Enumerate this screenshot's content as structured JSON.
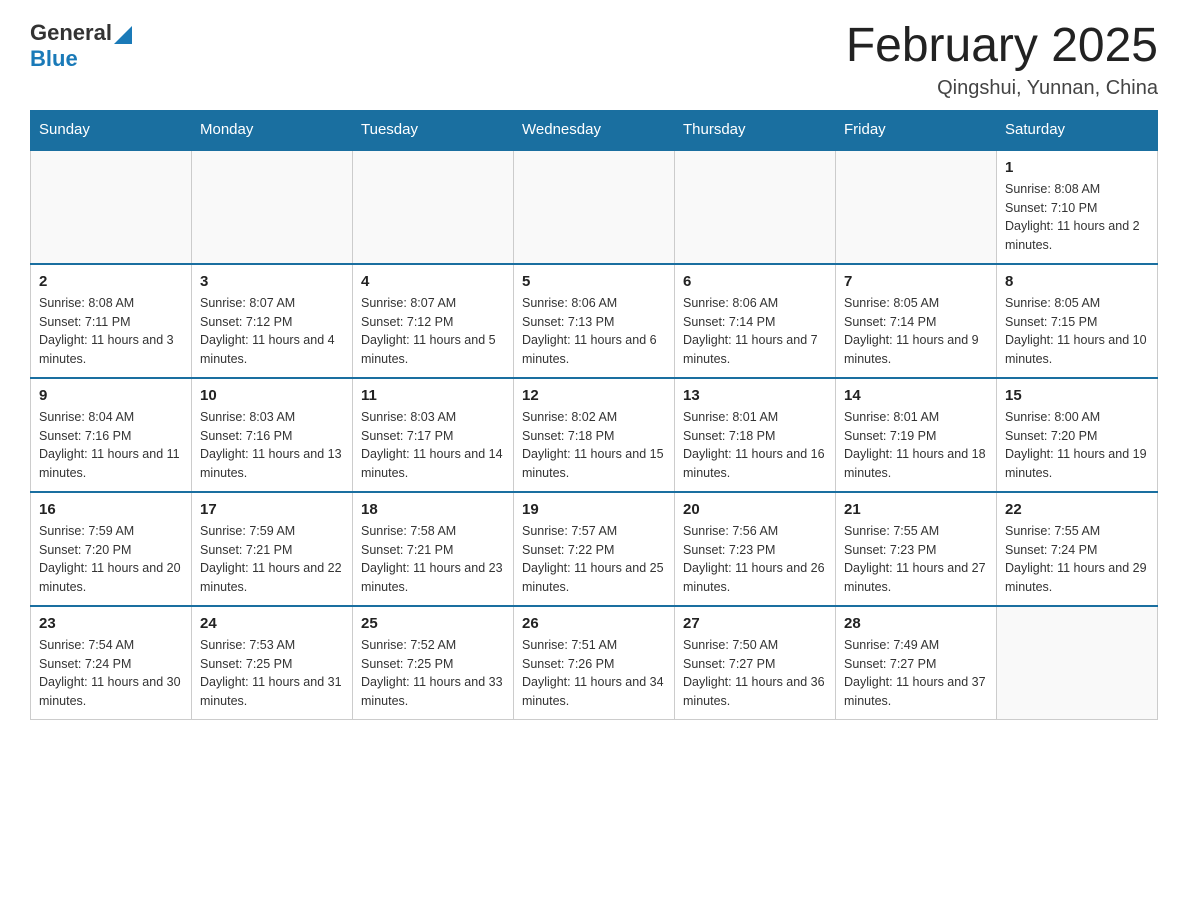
{
  "header": {
    "logo_general": "General",
    "logo_blue": "Blue",
    "title": "February 2025",
    "subtitle": "Qingshui, Yunnan, China"
  },
  "days_of_week": [
    "Sunday",
    "Monday",
    "Tuesday",
    "Wednesday",
    "Thursday",
    "Friday",
    "Saturday"
  ],
  "weeks": [
    [
      {
        "day": "",
        "info": ""
      },
      {
        "day": "",
        "info": ""
      },
      {
        "day": "",
        "info": ""
      },
      {
        "day": "",
        "info": ""
      },
      {
        "day": "",
        "info": ""
      },
      {
        "day": "",
        "info": ""
      },
      {
        "day": "1",
        "info": "Sunrise: 8:08 AM\nSunset: 7:10 PM\nDaylight: 11 hours and 2 minutes."
      }
    ],
    [
      {
        "day": "2",
        "info": "Sunrise: 8:08 AM\nSunset: 7:11 PM\nDaylight: 11 hours and 3 minutes."
      },
      {
        "day": "3",
        "info": "Sunrise: 8:07 AM\nSunset: 7:12 PM\nDaylight: 11 hours and 4 minutes."
      },
      {
        "day": "4",
        "info": "Sunrise: 8:07 AM\nSunset: 7:12 PM\nDaylight: 11 hours and 5 minutes."
      },
      {
        "day": "5",
        "info": "Sunrise: 8:06 AM\nSunset: 7:13 PM\nDaylight: 11 hours and 6 minutes."
      },
      {
        "day": "6",
        "info": "Sunrise: 8:06 AM\nSunset: 7:14 PM\nDaylight: 11 hours and 7 minutes."
      },
      {
        "day": "7",
        "info": "Sunrise: 8:05 AM\nSunset: 7:14 PM\nDaylight: 11 hours and 9 minutes."
      },
      {
        "day": "8",
        "info": "Sunrise: 8:05 AM\nSunset: 7:15 PM\nDaylight: 11 hours and 10 minutes."
      }
    ],
    [
      {
        "day": "9",
        "info": "Sunrise: 8:04 AM\nSunset: 7:16 PM\nDaylight: 11 hours and 11 minutes."
      },
      {
        "day": "10",
        "info": "Sunrise: 8:03 AM\nSunset: 7:16 PM\nDaylight: 11 hours and 13 minutes."
      },
      {
        "day": "11",
        "info": "Sunrise: 8:03 AM\nSunset: 7:17 PM\nDaylight: 11 hours and 14 minutes."
      },
      {
        "day": "12",
        "info": "Sunrise: 8:02 AM\nSunset: 7:18 PM\nDaylight: 11 hours and 15 minutes."
      },
      {
        "day": "13",
        "info": "Sunrise: 8:01 AM\nSunset: 7:18 PM\nDaylight: 11 hours and 16 minutes."
      },
      {
        "day": "14",
        "info": "Sunrise: 8:01 AM\nSunset: 7:19 PM\nDaylight: 11 hours and 18 minutes."
      },
      {
        "day": "15",
        "info": "Sunrise: 8:00 AM\nSunset: 7:20 PM\nDaylight: 11 hours and 19 minutes."
      }
    ],
    [
      {
        "day": "16",
        "info": "Sunrise: 7:59 AM\nSunset: 7:20 PM\nDaylight: 11 hours and 20 minutes."
      },
      {
        "day": "17",
        "info": "Sunrise: 7:59 AM\nSunset: 7:21 PM\nDaylight: 11 hours and 22 minutes."
      },
      {
        "day": "18",
        "info": "Sunrise: 7:58 AM\nSunset: 7:21 PM\nDaylight: 11 hours and 23 minutes."
      },
      {
        "day": "19",
        "info": "Sunrise: 7:57 AM\nSunset: 7:22 PM\nDaylight: 11 hours and 25 minutes."
      },
      {
        "day": "20",
        "info": "Sunrise: 7:56 AM\nSunset: 7:23 PM\nDaylight: 11 hours and 26 minutes."
      },
      {
        "day": "21",
        "info": "Sunrise: 7:55 AM\nSunset: 7:23 PM\nDaylight: 11 hours and 27 minutes."
      },
      {
        "day": "22",
        "info": "Sunrise: 7:55 AM\nSunset: 7:24 PM\nDaylight: 11 hours and 29 minutes."
      }
    ],
    [
      {
        "day": "23",
        "info": "Sunrise: 7:54 AM\nSunset: 7:24 PM\nDaylight: 11 hours and 30 minutes."
      },
      {
        "day": "24",
        "info": "Sunrise: 7:53 AM\nSunset: 7:25 PM\nDaylight: 11 hours and 31 minutes."
      },
      {
        "day": "25",
        "info": "Sunrise: 7:52 AM\nSunset: 7:25 PM\nDaylight: 11 hours and 33 minutes."
      },
      {
        "day": "26",
        "info": "Sunrise: 7:51 AM\nSunset: 7:26 PM\nDaylight: 11 hours and 34 minutes."
      },
      {
        "day": "27",
        "info": "Sunrise: 7:50 AM\nSunset: 7:27 PM\nDaylight: 11 hours and 36 minutes."
      },
      {
        "day": "28",
        "info": "Sunrise: 7:49 AM\nSunset: 7:27 PM\nDaylight: 11 hours and 37 minutes."
      },
      {
        "day": "",
        "info": ""
      }
    ]
  ]
}
